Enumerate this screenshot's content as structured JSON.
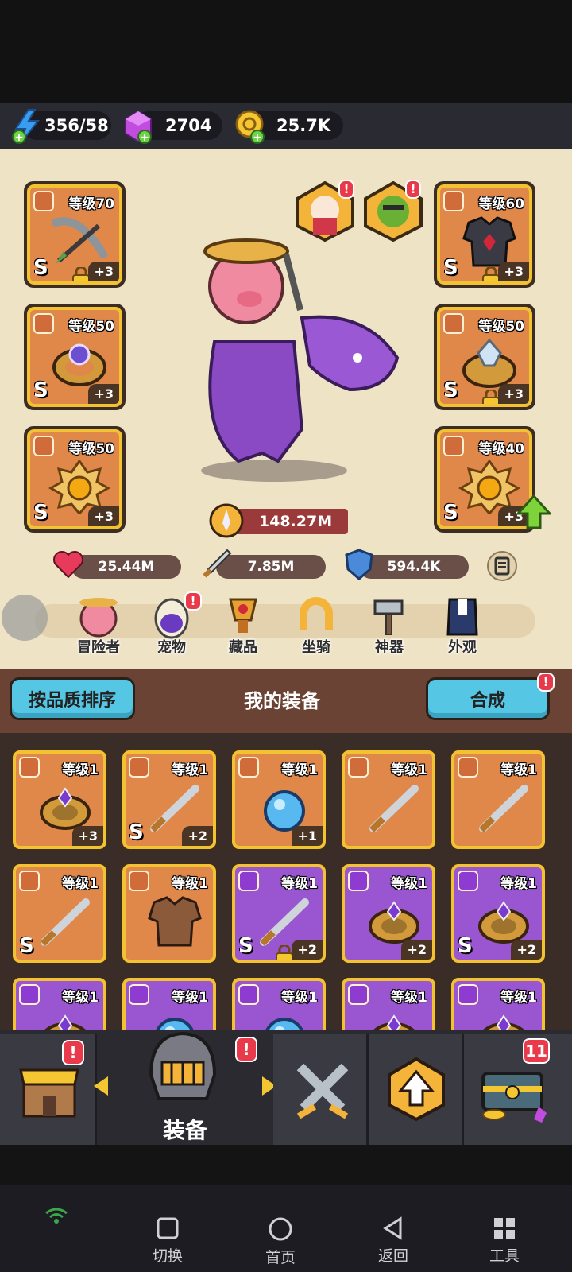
{
  "resources": {
    "energy": "356/58",
    "gems": "2704",
    "coins": "25.7K"
  },
  "hero_slots": {
    "left": [
      {
        "level": "等级70",
        "grade": "S",
        "plus": "+3",
        "type": "weapon",
        "locked": true
      },
      {
        "level": "等级50",
        "grade": "S",
        "plus": "+3",
        "type": "ring"
      },
      {
        "level": "等级50",
        "grade": "S",
        "plus": "+3",
        "type": "amulet"
      }
    ],
    "right": [
      {
        "level": "等级60",
        "grade": "S",
        "plus": "+3",
        "type": "armor",
        "locked": true
      },
      {
        "level": "等级50",
        "grade": "S",
        "plus": "+3",
        "type": "ring",
        "locked": true
      },
      {
        "level": "等级40",
        "grade": "S",
        "plus": "+3",
        "type": "amulet",
        "upgrade": true
      }
    ]
  },
  "power": "148.27M",
  "stats": {
    "hp": "25.44M",
    "attack": "7.85M",
    "defense": "594.4K"
  },
  "tabs": [
    "冒险者",
    "宠物",
    "藏品",
    "坐骑",
    "神器",
    "外观"
  ],
  "actions": {
    "sort_button": "按品质排序",
    "title": "我的装备",
    "merge_button": "合成"
  },
  "inventory": [
    {
      "level": "等级1",
      "plus": "+3",
      "grade": "",
      "rarity": "orange",
      "type": "ring"
    },
    {
      "level": "等级1",
      "plus": "+2",
      "grade": "S",
      "rarity": "orange",
      "type": "weapon"
    },
    {
      "level": "等级1",
      "plus": "+1",
      "grade": "",
      "rarity": "orange",
      "type": "amulet"
    },
    {
      "level": "等级1",
      "plus": "",
      "grade": "",
      "rarity": "orange",
      "type": "weapon"
    },
    {
      "level": "等级1",
      "plus": "",
      "grade": "",
      "rarity": "orange",
      "type": "weapon"
    },
    {
      "level": "等级1",
      "plus": "",
      "grade": "S",
      "rarity": "orange",
      "type": "weapon"
    },
    {
      "level": "等级1",
      "plus": "",
      "grade": "",
      "rarity": "orange",
      "type": "armor"
    },
    {
      "level": "等级1",
      "plus": "+2",
      "grade": "S",
      "rarity": "purple",
      "type": "weapon",
      "locked": true
    },
    {
      "level": "等级1",
      "plus": "+2",
      "grade": "",
      "rarity": "purple",
      "type": "ring"
    },
    {
      "level": "等级1",
      "plus": "+2",
      "grade": "S",
      "rarity": "purple",
      "type": "ring"
    },
    {
      "level": "等级1",
      "plus": "",
      "grade": "",
      "rarity": "purple",
      "type": "ring"
    },
    {
      "level": "等级1",
      "plus": "",
      "grade": "",
      "rarity": "purple",
      "type": "amulet"
    },
    {
      "level": "等级1",
      "plus": "",
      "grade": "",
      "rarity": "purple",
      "type": "amulet"
    },
    {
      "level": "等级1",
      "plus": "",
      "grade": "",
      "rarity": "purple",
      "type": "ring"
    },
    {
      "level": "等级1",
      "plus": "",
      "grade": "",
      "rarity": "purple",
      "type": "ring"
    }
  ],
  "bottom_nav": {
    "active_label": "装备",
    "chest_badge": "11",
    "alert": "!"
  },
  "system_nav": {
    "switch": "切换",
    "home": "首页",
    "back": "返回",
    "tools": "工具"
  },
  "colors": {
    "gold_border": "#f2c230",
    "orange_slot": "#e0874a",
    "purple_slot": "#9a56d0",
    "parchment": "#efe3c6",
    "button_blue": "#55c6e4",
    "alert_red": "#e83a4a"
  }
}
